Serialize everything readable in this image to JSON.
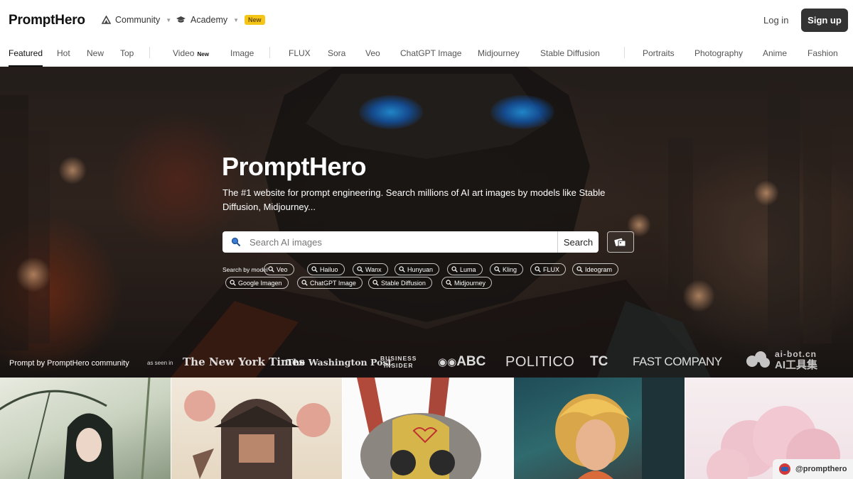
{
  "header": {
    "logo": "PromptHero",
    "community_label": "Community",
    "academy_label": "Academy",
    "academy_badge": "New",
    "login_label": "Log in",
    "signup_label": "Sign up"
  },
  "tabs": {
    "featured": "Featured",
    "hot": "Hot",
    "new": "New",
    "top": "Top",
    "video": "Video",
    "video_badge": "New",
    "image": "Image",
    "flux": "FLUX",
    "sora": "Sora",
    "veo": "Veo",
    "chatgpt_image": "ChatGPT Image",
    "midjourney": "Midjourney",
    "stable_diffusion": "Stable Diffusion",
    "portraits": "Portraits",
    "photography": "Photography",
    "anime": "Anime",
    "fashion": "Fashion"
  },
  "hero": {
    "title": "PromptHero",
    "subtitle": "The #1 website for prompt engineering. Search millions of AI art images by models like Stable Diffusion, Midjourney...",
    "search_placeholder": "Search AI images",
    "search_button": "Search",
    "model_label": "Search by model",
    "models": [
      "Veo",
      "Hailuo",
      "Wanx",
      "Hunyuan",
      "Luma",
      "Kling",
      "FLUX",
      "Ideogram",
      "Google Imagen",
      "ChatGPT Image",
      "Stable Diffusion",
      "Midjourney"
    ],
    "credit": "Prompt by PromptHero community",
    "seen_in": "as seen in",
    "press": {
      "nyt": "The New York Times",
      "wapo": "The Washington Post",
      "bi_line1": "BUSINESS",
      "bi_line2": "INSIDER",
      "abc": "ABC",
      "politico": "POLITICO",
      "tc": "TC",
      "fastco": "FAST COMPANY"
    },
    "watermark_top": "ai-bot.cn",
    "watermark_bottom": "AI工具集",
    "image_search_icon": "image-search-icon",
    "search_icon": "search-icon"
  },
  "gallery": {
    "tiles": [
      "woman-with-umbrella",
      "pagoda-with-trees",
      "robot-rabbit-helmet",
      "blonde-woman-portrait",
      "pink-blossom-tree"
    ]
  },
  "footer_handle": {
    "handle": "@prompthero"
  },
  "colors": {
    "accent_dark": "#333333",
    "badge_yellow": "#f5c518",
    "eye_blue": "#28aaff"
  }
}
